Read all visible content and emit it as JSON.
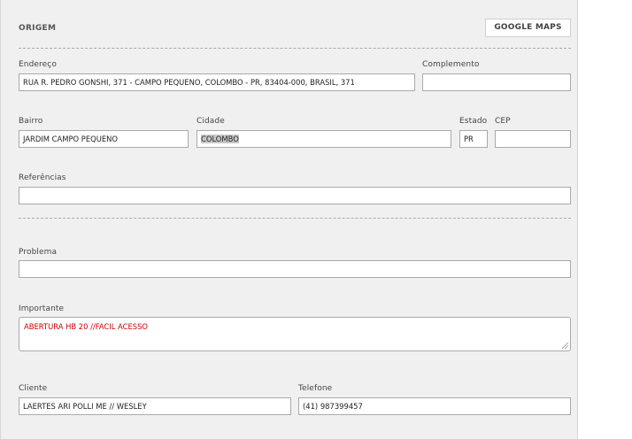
{
  "section": {
    "title": "ORIGEM",
    "maps_button": "GOOGLE MAPS"
  },
  "endereco": {
    "label": "Endereço",
    "value": "RUA R. PEDRO GONSHI, 371 - CAMPO PEQUENO, COLOMBO - PR, 83404-000, BRASIL, 371"
  },
  "complemento": {
    "label": "Complemento",
    "value": ""
  },
  "bairro": {
    "label": "Bairro",
    "value": "JARDIM CAMPO PEQUENO"
  },
  "cidade": {
    "label": "Cidade",
    "value": "COLOMBO"
  },
  "estado": {
    "label": "Estado",
    "value": "PR"
  },
  "cep": {
    "label": "CEP",
    "value": ""
  },
  "referencias": {
    "label": "Referências",
    "value": ""
  },
  "problema": {
    "label": "Problema",
    "value": ""
  },
  "importante": {
    "label": "Importante",
    "value": "ABERTURA HB 20 //FACIL ACESSO",
    "value_color": "#cc0000"
  },
  "cliente": {
    "label": "Cliente",
    "value": "LAERTES ARI POLLI ME // WESLEY"
  },
  "telefone": {
    "label": "Telefone",
    "value": "(41) 987399457"
  }
}
